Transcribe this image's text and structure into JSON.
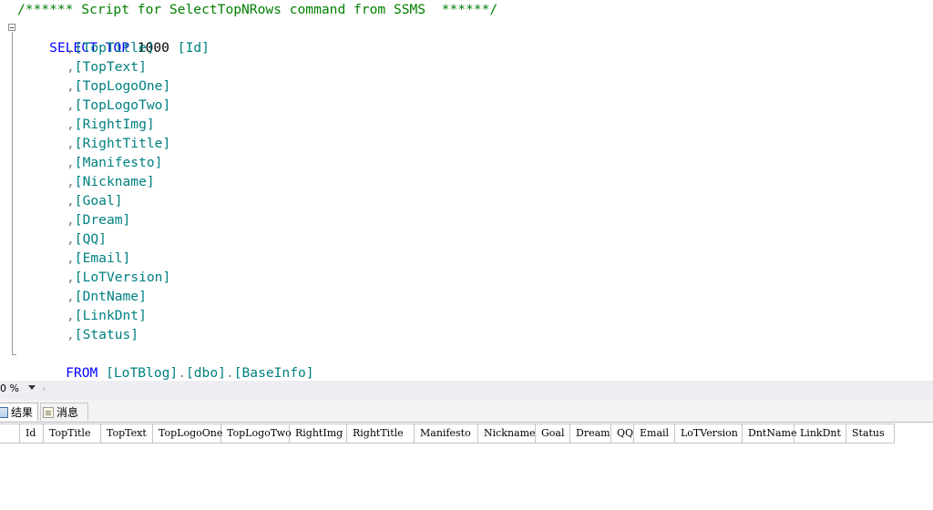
{
  "editor": {
    "comment": "/****** Script for SelectTopNRows command from SSMS  ******/",
    "select_kw": "SELECT",
    "top_kw": "TOP",
    "top_n": "1000",
    "first_col": "[Id]",
    "columns": [
      "[TopTitle]",
      "[TopText]",
      "[TopLogoOne]",
      "[TopLogoTwo]",
      "[RightImg]",
      "[RightTitle]",
      "[Manifesto]",
      "[Nickname]",
      "[Goal]",
      "[Dream]",
      "[QQ]",
      "[Email]",
      "[LoTVersion]",
      "[DntName]",
      "[LinkDnt]",
      "[Status]"
    ],
    "from_kw": "FROM",
    "db": "[LoTBlog]",
    "schema": "[dbo]",
    "table": "[BaseInfo]"
  },
  "zoom": {
    "value": "0 %"
  },
  "tabs": {
    "results": "结果",
    "messages": "消息"
  },
  "grid": {
    "headers": [
      "Id",
      "TopTitle",
      "TopText",
      "TopLogoOne",
      "TopLogoTwo",
      "RightImg",
      "RightTitle",
      "Manifesto",
      "Nickname",
      "Goal",
      "Dream",
      "QQ",
      "Email",
      "LoTVersion",
      "DntName",
      "LinkDnt",
      "Status"
    ]
  }
}
